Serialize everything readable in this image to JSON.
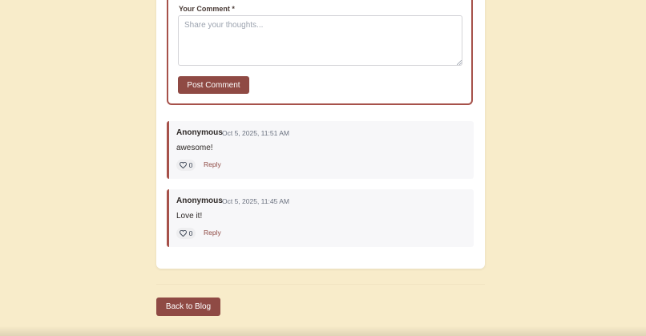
{
  "comment_form": {
    "label": "Your Comment *",
    "placeholder": "Share your thoughts...",
    "value": "",
    "submit_label": "Post Comment"
  },
  "comments": [
    {
      "author": "Anonymous",
      "date": "Oct 5, 2025, 11:51 AM",
      "text": "awesome!",
      "likes": "0",
      "reply_label": "Reply"
    },
    {
      "author": "Anonymous",
      "date": "Oct 5, 2025, 11:45 AM",
      "text": "Love it!",
      "likes": "0",
      "reply_label": "Reply"
    }
  ],
  "back_button": {
    "label": "Back to Blog"
  },
  "colors": {
    "background": "#f8ecca",
    "accent": "#8f4a44",
    "border_accent": "#a6514a",
    "comment_bg": "#f7f7f9"
  },
  "icons": {
    "like": "heart-icon",
    "resize": "resize-grip-icon"
  }
}
